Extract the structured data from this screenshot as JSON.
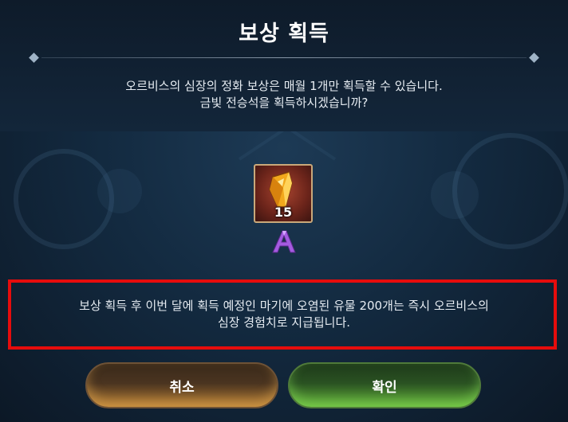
{
  "dialog": {
    "title": "보상 획득",
    "message_line1": "오르비스의 심장의 정화 보상은 매월 1개만 획득할 수 있습니다.",
    "message_line2": "금빛 전승석을 획득하시겠습니까?"
  },
  "reward": {
    "icon": "golden-crystal-icon",
    "count": "15",
    "grade_icon": "grade-a-icon",
    "grade_color": "#a45be0"
  },
  "notice": {
    "line1": "보상 획득 후 이번 달에 획득 예정인 마기에 오염된 유물 200개는 즉시 오르비스의",
    "line2": "심장 경험치로 지급됩니다."
  },
  "buttons": {
    "cancel_label": "취소",
    "confirm_label": "확인"
  },
  "colors": {
    "highlight_border": "#e60c0c",
    "cancel_button": "#b07a33",
    "confirm_button": "#63b03a"
  }
}
